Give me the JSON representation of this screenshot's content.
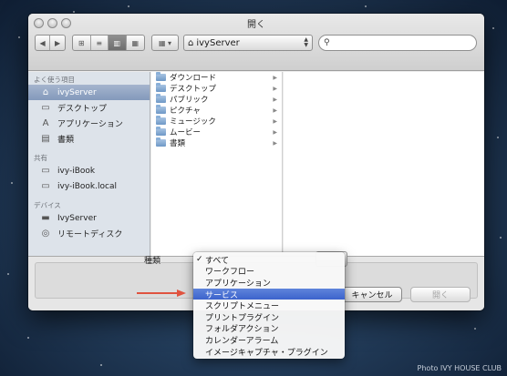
{
  "window": {
    "title": "開く"
  },
  "toolbar": {
    "back_label": "◀",
    "forward_label": "▶",
    "view_icon_label": "⊞",
    "view_list_label": "≡",
    "view_column_label": "▥",
    "view_flow_label": "▦",
    "arrange_label": "▦ ▾",
    "path_label": "ivyServer",
    "search_icon": "search-icon"
  },
  "sidebar": {
    "sections": [
      {
        "header": "よく使う項目",
        "items": [
          {
            "label": "ivyServer",
            "icon": "home-icon",
            "selected": true
          },
          {
            "label": "デスクトップ",
            "icon": "desktop-icon",
            "selected": false
          },
          {
            "label": "アプリケーション",
            "icon": "applications-icon",
            "selected": false
          },
          {
            "label": "書類",
            "icon": "documents-icon",
            "selected": false
          }
        ]
      },
      {
        "header": "共有",
        "items": [
          {
            "label": "ivy-iBook",
            "icon": "computer-icon",
            "selected": false
          },
          {
            "label": "ivy-iBook.local",
            "icon": "computer-icon",
            "selected": false
          }
        ]
      },
      {
        "header": "デバイス",
        "items": [
          {
            "label": "IvyServer",
            "icon": "drive-icon",
            "selected": false
          },
          {
            "label": "リモートディスク",
            "icon": "disc-icon",
            "selected": false
          }
        ]
      }
    ]
  },
  "files": [
    "ダウンロード",
    "デスクトップ",
    "パブリック",
    "ピクチャ",
    "ミュージック",
    "ムービー",
    "書類"
  ],
  "options": {
    "type_label": "種類"
  },
  "buttons": {
    "cancel": "キャンセル",
    "open": "開く"
  },
  "menu": {
    "items": [
      {
        "label": "すべて",
        "checked": true,
        "highlighted": false
      },
      {
        "label": "ワークフロー",
        "checked": false,
        "highlighted": false
      },
      {
        "label": "アプリケーション",
        "checked": false,
        "highlighted": false
      },
      {
        "label": "サービス",
        "checked": false,
        "highlighted": true
      },
      {
        "label": "スクリプトメニュー",
        "checked": false,
        "highlighted": false
      },
      {
        "label": "プリントプラグイン",
        "checked": false,
        "highlighted": false
      },
      {
        "label": "フォルダアクション",
        "checked": false,
        "highlighted": false
      },
      {
        "label": "カレンダーアラーム",
        "checked": false,
        "highlighted": false
      },
      {
        "label": "イメージキャプチャ・プラグイン",
        "checked": false,
        "highlighted": false
      }
    ]
  },
  "credit": "Photo IVY HOUSE CLUB",
  "colors": {
    "highlight": "#3c63cc",
    "arrow": "#e0533f",
    "sidebar_bg": "#dde3ea"
  }
}
